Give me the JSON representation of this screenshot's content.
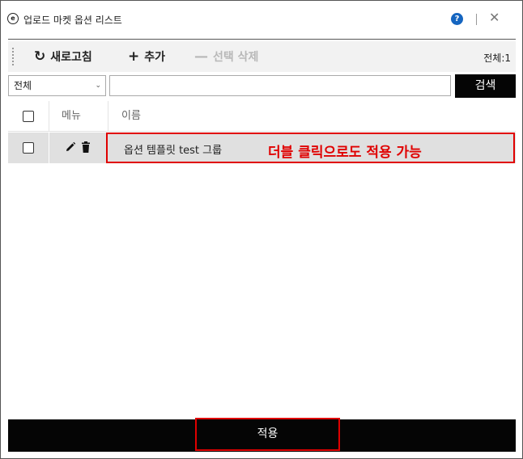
{
  "window": {
    "title": "업로드 마켓 옵션 리스트",
    "app_icon_glyph": "e",
    "help_glyph": "?",
    "close_glyph": "✕"
  },
  "toolbar": {
    "refresh_icon": "↻",
    "refresh_label": "새로고침",
    "add_icon": "+",
    "add_label": "추가",
    "delete_icon": "—",
    "delete_label": "선택 삭제",
    "total_label": "전체:1"
  },
  "search": {
    "filter_selected": "전체",
    "input_value": "",
    "input_placeholder": "",
    "button_label": "검색"
  },
  "table": {
    "headers": {
      "menu": "메뉴",
      "name": "이름"
    },
    "rows": [
      {
        "name": "옵션 템플릿 test 그룹",
        "checked": false
      }
    ]
  },
  "annotation": {
    "text": "더블 클릭으로도 적용 가능",
    "color": "#e00000"
  },
  "footer": {
    "apply_label": "적용"
  },
  "colors": {
    "accent_dark": "#050505",
    "help_blue": "#1565c0",
    "highlight_red": "#e00000",
    "row_selected": "#e0e0e0"
  }
}
